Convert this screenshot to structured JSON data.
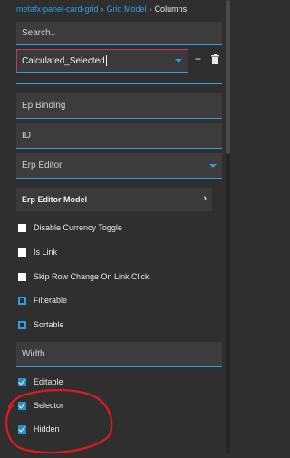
{
  "breadcrumb": {
    "items": [
      "metafx-panel-card-grid",
      "Grid Model"
    ],
    "separator": "›",
    "current": "Columns"
  },
  "search": {
    "placeholder": "Search.."
  },
  "column_select": {
    "value": "Calculated_Selected",
    "add_label": "+"
  },
  "fields": {
    "ep_binding": {
      "placeholder": "Ep Binding"
    },
    "id": {
      "placeholder": "ID"
    },
    "erp_editor": {
      "value": "Erp Editor"
    },
    "width": {
      "placeholder": "Width"
    }
  },
  "erp_editor_model": {
    "label": "Erp Editor Model",
    "chevron": "›"
  },
  "options": [
    {
      "label": "Disable Currency Toggle",
      "state": "unchecked"
    },
    {
      "label": "Is Link",
      "state": "unchecked"
    },
    {
      "label": "Skip Row Change On Link Click",
      "state": "unchecked"
    },
    {
      "label": "Filterable",
      "state": "indeterminate"
    },
    {
      "label": "Sortable",
      "state": "indeterminate"
    },
    {
      "label": "Editable",
      "state": "checked"
    },
    {
      "label": "Selector",
      "state": "checked"
    },
    {
      "label": "Hidden",
      "state": "checked"
    }
  ],
  "colors": {
    "accent": "#2ea0dc",
    "background": "#2f2f30",
    "annotation": "#e0191d"
  }
}
